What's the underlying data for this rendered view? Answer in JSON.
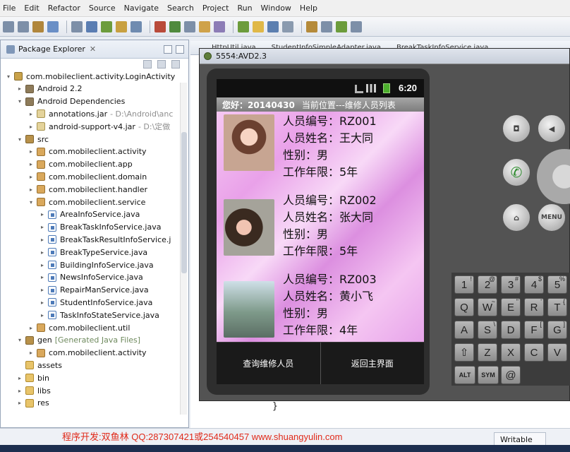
{
  "menu": [
    "File",
    "Edit",
    "Refactor",
    "Source",
    "Navigate",
    "Search",
    "Project",
    "Run",
    "Window",
    "Help"
  ],
  "explorer": {
    "title": "Package Explorer",
    "close": "✕",
    "rows": [
      {
        "label": "com.mobileclient.activity.LoginActivity",
        "extra": "",
        "icon": "proj",
        "indent": 0,
        "twisty": "▾"
      },
      {
        "label": "Android 2.2",
        "extra": "",
        "icon": "lib",
        "indent": 1,
        "twisty": "▸"
      },
      {
        "label": "Android Dependencies",
        "extra": "",
        "icon": "lib",
        "indent": 1,
        "twisty": "▾"
      },
      {
        "label": "annotations.jar",
        "extra": "- D:\\Android\\anc",
        "icon": "jar",
        "indent": 2,
        "twisty": "▸"
      },
      {
        "label": "android-support-v4.jar",
        "extra": "- D:\\定做",
        "icon": "jar",
        "indent": 2,
        "twisty": "▸"
      },
      {
        "label": "src",
        "extra": "",
        "icon": "src",
        "indent": 1,
        "twisty": "▾"
      },
      {
        "label": "com.mobileclient.activity",
        "extra": "",
        "icon": "pkg",
        "indent": 2,
        "twisty": "▸"
      },
      {
        "label": "com.mobileclient.app",
        "extra": "",
        "icon": "pkg",
        "indent": 2,
        "twisty": "▸"
      },
      {
        "label": "com.mobileclient.domain",
        "extra": "",
        "icon": "pkg",
        "indent": 2,
        "twisty": "▸"
      },
      {
        "label": "com.mobileclient.handler",
        "extra": "",
        "icon": "pkg",
        "indent": 2,
        "twisty": "▸"
      },
      {
        "label": "com.mobileclient.service",
        "extra": "",
        "icon": "pkg",
        "indent": 2,
        "twisty": "▾"
      },
      {
        "label": "AreaInfoService.java",
        "extra": "",
        "icon": "java",
        "indent": 3,
        "twisty": "▸"
      },
      {
        "label": "BreakTaskInfoService.java",
        "extra": "",
        "icon": "java",
        "indent": 3,
        "twisty": "▸"
      },
      {
        "label": "BreakTaskResultInfoService.j",
        "extra": "",
        "icon": "java",
        "indent": 3,
        "twisty": "▸"
      },
      {
        "label": "BreakTypeService.java",
        "extra": "",
        "icon": "java",
        "indent": 3,
        "twisty": "▸"
      },
      {
        "label": "BuildingInfoService.java",
        "extra": "",
        "icon": "java",
        "indent": 3,
        "twisty": "▸"
      },
      {
        "label": "NewsInfoService.java",
        "extra": "",
        "icon": "java",
        "indent": 3,
        "twisty": "▸"
      },
      {
        "label": "RepairManService.java",
        "extra": "",
        "icon": "java",
        "indent": 3,
        "twisty": "▸"
      },
      {
        "label": "StudentInfoService.java",
        "extra": "",
        "icon": "java",
        "indent": 3,
        "twisty": "▸"
      },
      {
        "label": "TaskInfoStateService.java",
        "extra": "",
        "icon": "java",
        "indent": 3,
        "twisty": "▸"
      },
      {
        "label": "com.mobileclient.util",
        "extra": "",
        "icon": "pkg",
        "indent": 2,
        "twisty": "▸"
      },
      {
        "label": "gen",
        "extra": "[Generated Java Files]",
        "icon": "src",
        "indent": 1,
        "twisty": "▾"
      },
      {
        "label": "com.mobileclient.activity",
        "extra": "",
        "icon": "pkg",
        "indent": 2,
        "twisty": "▸"
      },
      {
        "label": "assets",
        "extra": "",
        "icon": "folder",
        "indent": 1,
        "twisty": ""
      },
      {
        "label": "bin",
        "extra": "",
        "icon": "folder",
        "indent": 1,
        "twisty": "▸"
      },
      {
        "label": "libs",
        "extra": "",
        "icon": "folder",
        "indent": 1,
        "twisty": "▸"
      },
      {
        "label": "res",
        "extra": "",
        "icon": "folder",
        "indent": 1,
        "twisty": "▸"
      }
    ]
  },
  "editor": {
    "tabs": [
      "HttpUtil.java",
      "StudentInfoSimpleAdapter.java",
      "BreakTaskInfoService.java"
    ],
    "brace": "}"
  },
  "emulator": {
    "title": "5554:AVD2.3",
    "time": "6:20",
    "greeting": "您好：20140430",
    "location": "当前位置---维修人员列表",
    "people": [
      {
        "id_label": "人员编号：RZ001",
        "name_label": "人员姓名：王大同",
        "gender_label": "性别：男",
        "years_label": "工作年限：5年"
      },
      {
        "id_label": "人员编号：RZ002",
        "name_label": "人员姓名：张大同",
        "gender_label": "性别：男",
        "years_label": "工作年限：5年"
      },
      {
        "id_label": "人员编号：RZ003",
        "name_label": "人员姓名：黄小飞",
        "gender_label": "性别：男",
        "years_label": "工作年限：4年"
      }
    ],
    "buttons": {
      "query": "查询维修人员",
      "back": "返回主界面"
    },
    "controls": {
      "menu": "MENU"
    },
    "keys": [
      {
        "main": "1",
        "alt": "!"
      },
      {
        "main": "2",
        "alt": "@"
      },
      {
        "main": "3",
        "alt": "#"
      },
      {
        "main": "4",
        "alt": "$"
      },
      {
        "main": "5",
        "alt": "%"
      },
      {
        "main": "Q",
        "alt": ""
      },
      {
        "main": "W",
        "alt": "~"
      },
      {
        "main": "E",
        "alt": "\""
      },
      {
        "main": "R",
        "alt": "'"
      },
      {
        "main": "T",
        "alt": "{"
      },
      {
        "main": "A",
        "alt": ""
      },
      {
        "main": "S",
        "alt": "\\"
      },
      {
        "main": "D",
        "alt": ""
      },
      {
        "main": "F",
        "alt": "["
      },
      {
        "main": "G",
        "alt": "]"
      },
      {
        "main": "⇧",
        "alt": ""
      },
      {
        "main": "Z",
        "alt": ""
      },
      {
        "main": "X",
        "alt": ""
      },
      {
        "main": "C",
        "alt": ""
      },
      {
        "main": "V",
        "alt": ""
      },
      {
        "main": "ALT",
        "alt": ""
      },
      {
        "main": "SYM",
        "alt": ""
      },
      {
        "main": "@",
        "alt": ""
      }
    ]
  },
  "status": {
    "watermark": "程序开发:双鱼林 QQ:287307421或254540457 www.shuangyulin.com",
    "writable": "Writable"
  }
}
